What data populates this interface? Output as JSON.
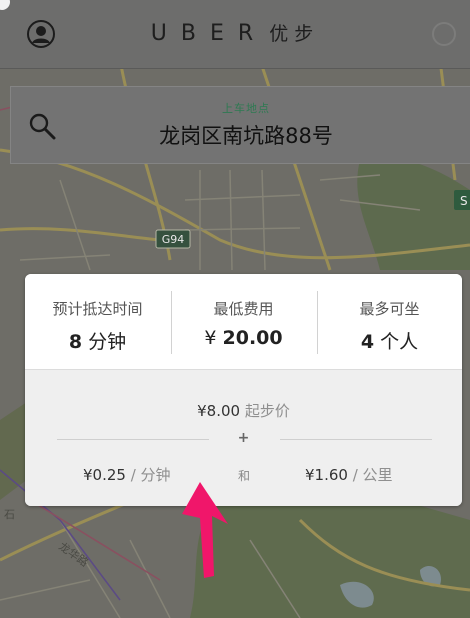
{
  "header": {
    "brand": "UBER",
    "brand_cn": "优步",
    "left_icon": "person-icon",
    "right_icon": "spinner-icon"
  },
  "map": {
    "road_shield": "G94",
    "right_badge": "S",
    "bottom_text": "石",
    "road_label": "龙华路"
  },
  "pickup": {
    "label": "上车地点",
    "address": "龙岗区南坑路88号",
    "icon": "search-icon"
  },
  "fare": {
    "eta": {
      "caption": "预计抵达时间",
      "value": "8",
      "unit": "分钟"
    },
    "min_fare": {
      "caption": "最低费用",
      "currency": "¥",
      "value": "20.00"
    },
    "capacity": {
      "caption": "最多可坐",
      "value": "4",
      "unit": "个人"
    },
    "base": {
      "amount": "¥8.00",
      "label": "起步价"
    },
    "plus": "+",
    "per_minute": {
      "amount": "¥0.25",
      "label": "/ 分钟"
    },
    "and": "和",
    "per_km": {
      "amount": "¥1.60",
      "label": "/ 公里"
    }
  },
  "colors": {
    "annotation_arrow": "#f0166a",
    "pickup_label": "#2e7a52"
  }
}
